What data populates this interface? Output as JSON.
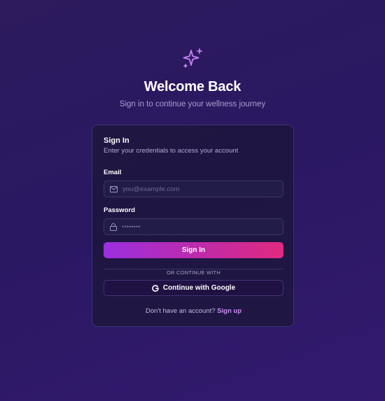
{
  "header": {
    "logo_icon": "sparkles-icon",
    "title": "Welcome Back",
    "subtitle": "Sign in to continue your wellness journey"
  },
  "card": {
    "title": "Sign In",
    "description": "Enter your credentials to access your account",
    "email": {
      "label": "Email",
      "placeholder": "you@example.com",
      "value": "",
      "icon": "mail-icon"
    },
    "password": {
      "label": "Password",
      "placeholder": "••••••••",
      "value": "",
      "icon": "lock-icon"
    },
    "signin_label": "Sign In",
    "divider_text": "OR CONTINUE WITH",
    "google_label": "Continue with Google",
    "google_icon": "google-icon",
    "footer_prompt": "Don't have an account?",
    "signup_label": "Sign up"
  },
  "colors": {
    "accent_start": "#9c2fe0",
    "accent_end": "#e02a7f",
    "logo": "#c680f2",
    "link": "#c88ff0"
  }
}
